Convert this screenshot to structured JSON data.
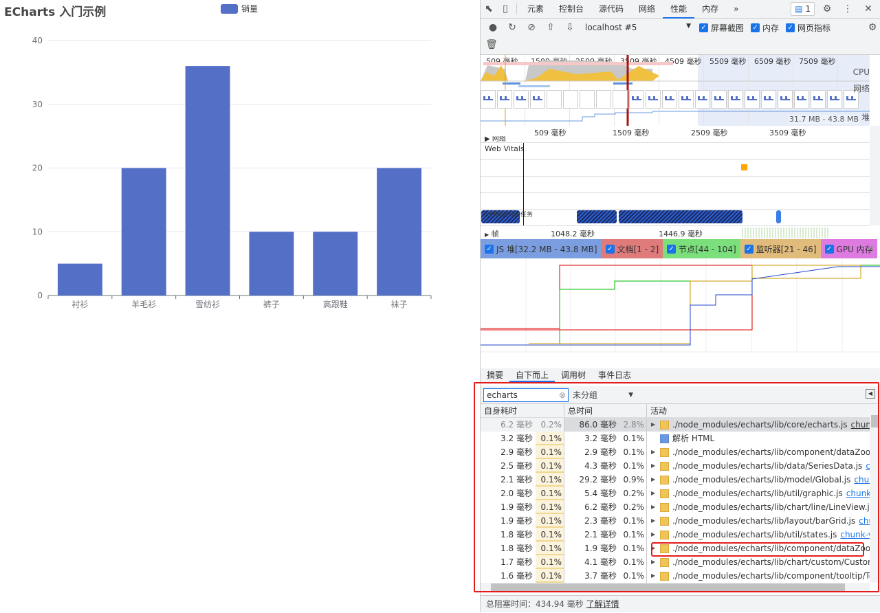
{
  "chart_data": {
    "type": "bar",
    "title": "ECharts 入门示例",
    "legend": [
      "销量"
    ],
    "legend_placement": "top",
    "categories": [
      "衬衫",
      "羊毛衫",
      "雪纺衫",
      "裤子",
      "高跟鞋",
      "袜子"
    ],
    "series": [
      {
        "name": "销量",
        "values": [
          5,
          20,
          36,
          10,
          10,
          20
        ]
      }
    ],
    "ylim": [
      0,
      40
    ],
    "yticks": [
      0,
      10,
      20,
      30,
      40
    ],
    "color": "#5470c6",
    "grid": true
  },
  "devtools": {
    "tabs": [
      "元素",
      "控制台",
      "源代码",
      "网络",
      "性能",
      "内存",
      "»"
    ],
    "active_tab": "性能",
    "issues_badge": "1",
    "target": "localhost #5",
    "checkboxes": [
      "屏幕截图",
      "内存",
      "网页指标"
    ],
    "overview_ticks": [
      "509 毫秒",
      "1509 毫秒",
      "2509 毫秒",
      "3509 毫秒",
      "4509 毫秒",
      "5509 毫秒",
      "6509 毫秒",
      "7509 毫秒"
    ],
    "overview_labels": {
      "cpu": "CPU",
      "net": "网络",
      "heap": "堆",
      "heap_range": "31.7 MB - 43.8 MB"
    },
    "main_ticks": [
      "509 毫秒",
      "1509 毫秒",
      "2509 毫秒",
      "3509 毫秒"
    ],
    "network_track": "网络",
    "web_vitals": "Web Vitals",
    "long_task": "长时间运行的任务",
    "frames": {
      "label": "帧",
      "t1": "1048.2 毫秒",
      "t2": "1446.9 毫秒"
    },
    "memory_counters": [
      {
        "label": "JS 堆[32.2 MB - 43.8 MB]",
        "color": "#7b9ee0"
      },
      {
        "label": "文档[1 - 2]",
        "color": "#e07b7b"
      },
      {
        "label": "节点[44 - 104]",
        "color": "#7be07b"
      },
      {
        "label": "监听器[21 - 46]",
        "color": "#e0bb7b"
      },
      {
        "label": "GPU 内存",
        "color": "#dd7be0"
      }
    ],
    "bottom_tabs": [
      "摘要",
      "自下而上",
      "调用树",
      "事件日志"
    ],
    "active_bottom_tab": "自下而上",
    "filter": {
      "value": "echarts",
      "grouping": "未分组"
    },
    "columns": [
      "自身耗时",
      "总时间",
      "活动"
    ],
    "rows": [
      {
        "self": "6.2 毫秒",
        "self_pct": "0.2%",
        "total": "86.0 毫秒",
        "total_pct": "2.8%",
        "activity": "./node_modules/echarts/lib/core/echarts.js",
        "link": "chunk-v...",
        "selected": true
      },
      {
        "self": "3.2 毫秒",
        "self_pct": "0.1%",
        "total": "3.2 毫秒",
        "total_pct": "0.1%",
        "activity": "解析 HTML",
        "link": "",
        "kind": "html"
      },
      {
        "self": "2.9 毫秒",
        "self_pct": "0.1%",
        "total": "2.9 毫秒",
        "total_pct": "0.1%",
        "activity": "./node_modules/echarts/lib/component/dataZoom/Sl",
        "link": ""
      },
      {
        "self": "2.5 毫秒",
        "self_pct": "0.1%",
        "total": "4.3 毫秒",
        "total_pct": "0.1%",
        "activity": "./node_modules/echarts/lib/data/SeriesData.js",
        "link": "chun..."
      },
      {
        "self": "2.1 毫秒",
        "self_pct": "0.1%",
        "total": "29.2 毫秒",
        "total_pct": "0.9%",
        "activity": "./node_modules/echarts/lib/model/Global.js",
        "link": "chunk-..."
      },
      {
        "self": "2.0 毫秒",
        "self_pct": "0.1%",
        "total": "5.4 毫秒",
        "total_pct": "0.2%",
        "activity": "./node_modules/echarts/lib/util/graphic.js",
        "link": "chunk-ve..."
      },
      {
        "self": "1.9 毫秒",
        "self_pct": "0.1%",
        "total": "6.2 毫秒",
        "total_pct": "0.2%",
        "activity": "./node_modules/echarts/lib/chart/line/LineView.js",
        "link": "c..."
      },
      {
        "self": "1.9 毫秒",
        "self_pct": "0.1%",
        "total": "2.3 毫秒",
        "total_pct": "0.1%",
        "activity": "./node_modules/echarts/lib/layout/barGrid.js",
        "link": "chunk..."
      },
      {
        "self": "1.8 毫秒",
        "self_pct": "0.1%",
        "total": "2.1 毫秒",
        "total_pct": "0.1%",
        "activity": "./node_modules/echarts/lib/util/states.js",
        "link": "chunk-ven..."
      },
      {
        "self": "1.8 毫秒",
        "self_pct": "0.1%",
        "total": "1.9 毫秒",
        "total_pct": "0.1%",
        "activity": "./node_modules/echarts/lib/component/dataZoom/Sl",
        "link": "",
        "highlighted": true
      },
      {
        "self": "1.7 毫秒",
        "self_pct": "0.1%",
        "total": "4.1 毫秒",
        "total_pct": "0.1%",
        "activity": "./node_modules/echarts/lib/chart/custom/CustomView",
        "link": ""
      },
      {
        "self": "1.6 毫秒",
        "self_pct": "0.1%",
        "total": "3.7 毫秒",
        "total_pct": "0.1%",
        "activity": "./node_modules/echarts/lib/component/tooltip/Toolti",
        "link": ""
      }
    ],
    "footer": {
      "label": "总阻塞时间：434.94 毫秒",
      "link": "了解详情"
    }
  }
}
